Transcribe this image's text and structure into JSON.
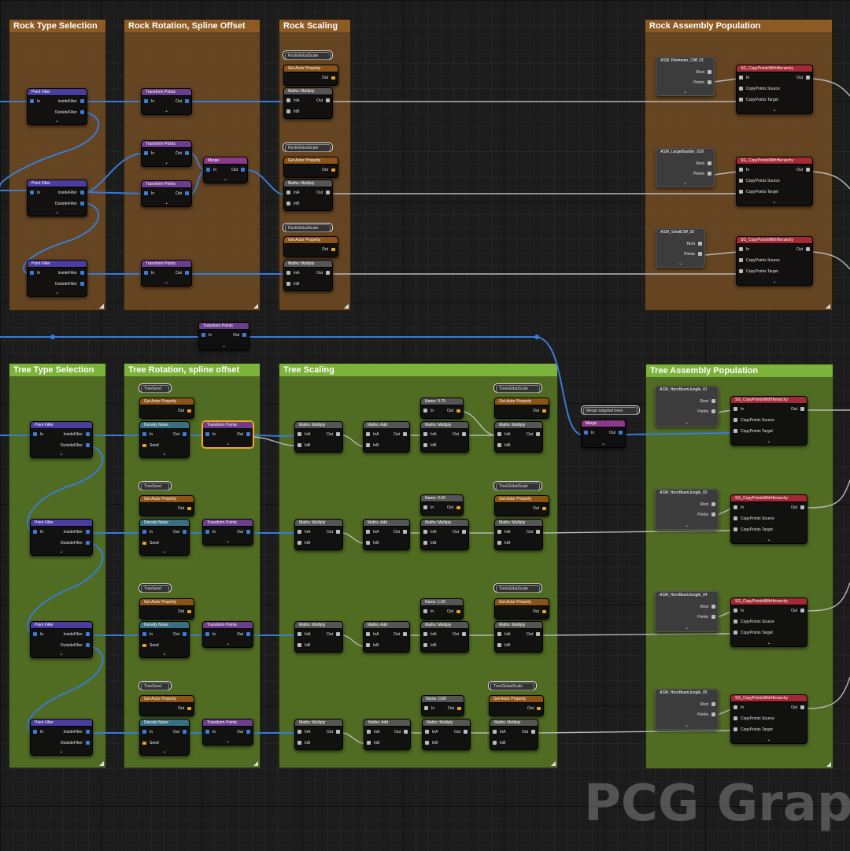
{
  "comments": {
    "rock_type": "Rock Type Selection",
    "rock_rot": "Rock Rotation, Spline Offset",
    "rock_scale": "Rock Scaling",
    "rock_asm": "Rock Assembly Population",
    "tree_type": "Tree Type Selection",
    "tree_rot": "Tree Rotation, spline offset",
    "tree_scale": "Tree Scaling",
    "tree_asm": "Tree Assembly Population"
  },
  "titles": {
    "point_filter": "Point Filter",
    "transform_points": "Transform Points",
    "merge": "Merge",
    "get_actor_property": "Get Actor Property",
    "maths_multiply": "Maths: Multiply",
    "maths_add": "Maths: Add",
    "density_noise": "Density Noise",
    "copy_points": "SG_CopyPointsWithHierarchy"
  },
  "pins": {
    "in": "In",
    "out": "Out",
    "inside": "InsideFilter",
    "outside": "OutsideFilter",
    "ina": "InA",
    "inb": "InB",
    "seed": "Seed",
    "root": "Root",
    "points": "Points",
    "cps": "CopyPoints Source",
    "cpt": "CopyPoints Target"
  },
  "pills": {
    "rock_global": "RockGlobalScale",
    "tree_global": "TreeGlobalScale",
    "tree_seed": "TreeSeed",
    "merge_targeted": "Merge targeted trees"
  },
  "const_names": [
    "Name: 0.75",
    "Name: 0.90",
    "Name: 1.00",
    "Name: 0.80"
  ],
  "rock_assets": [
    "ASM_Perimeter_Cliff_01",
    "ASM_LargeBoulder_018",
    "ASM_SmallCliff_02"
  ],
  "tree_assets": [
    "ASM_HornBeamJungle_01",
    "ASM_HornBeamJungle_02",
    "ASM_HornBeamJungle_04",
    "ASM_HornBeamJungle_05"
  ],
  "watermark": "PCG Graph",
  "colors": {
    "pin": "#3e7ad8",
    "wire": "#3a7bd5",
    "wire_gray": "#b9b9b9",
    "rock_comment": "#704a22",
    "tree_comment": "#7cb33a",
    "selected": "#f5a623"
  }
}
